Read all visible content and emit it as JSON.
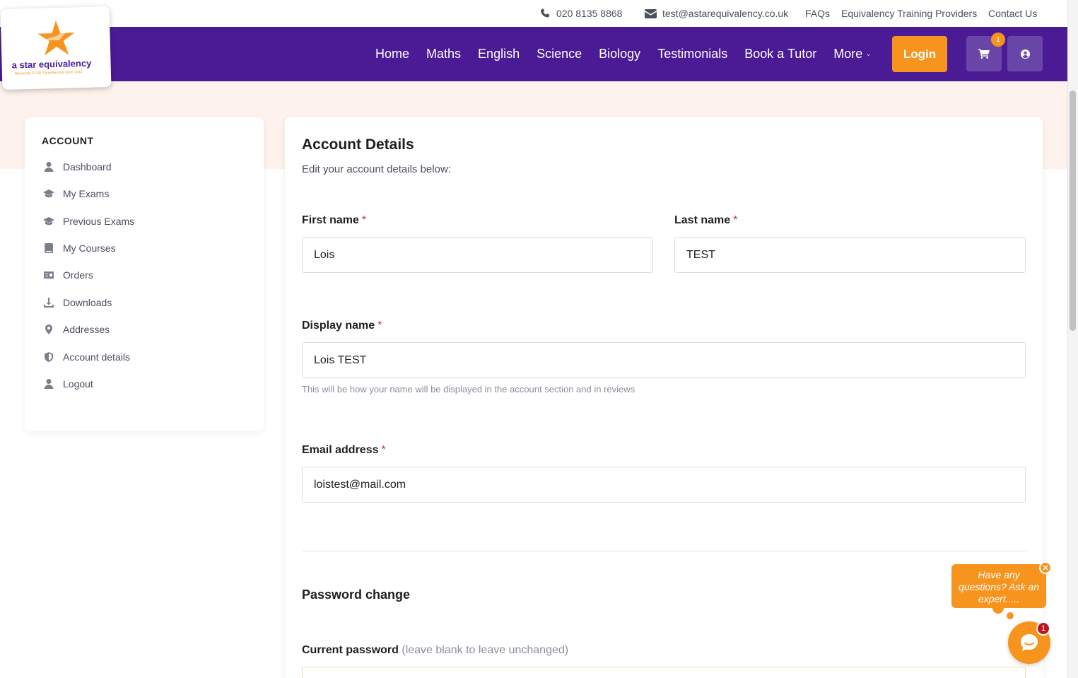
{
  "topbar": {
    "phone": "020 8135 8868",
    "email": "test@astarequivalency.co.uk",
    "links": [
      "FAQs",
      "Equivalency Training Providers",
      "Contact Us"
    ]
  },
  "logo": {
    "title": "a star equivalency",
    "tagline": "Delivering GCSE Equivalencies since 2012"
  },
  "nav": {
    "links": [
      "Home",
      "Maths",
      "English",
      "Science",
      "Biology",
      "Testimonials",
      "Book a Tutor",
      "More"
    ],
    "login_label": "Login",
    "cart_count": "1"
  },
  "sidebar": {
    "heading": "ACCOUNT",
    "items": [
      {
        "label": "Dashboard",
        "icon": "user-icon"
      },
      {
        "label": "My Exams",
        "icon": "graduation-cap-icon"
      },
      {
        "label": "Previous Exams",
        "icon": "graduation-cap-icon"
      },
      {
        "label": "My Courses",
        "icon": "book-icon"
      },
      {
        "label": "Orders",
        "icon": "receipt-icon"
      },
      {
        "label": "Downloads",
        "icon": "download-icon"
      },
      {
        "label": "Addresses",
        "icon": "map-pin-icon"
      },
      {
        "label": "Account details",
        "icon": "shield-icon"
      },
      {
        "label": "Logout",
        "icon": "user-icon"
      }
    ]
  },
  "main": {
    "title": "Account Details",
    "subtitle": "Edit your account details below:",
    "first_name_label": "First name",
    "first_name_value": "Lois",
    "last_name_label": "Last name",
    "last_name_value": "TEST",
    "display_name_label": "Display name",
    "display_name_value": "Lois TEST",
    "display_name_help": "This will be how your name will be displayed in the account section and in reviews",
    "email_label": "Email address",
    "email_value": "loistest@mail.com",
    "required_mark": "*",
    "password_section_title": "Password change",
    "current_password_label": "Current password",
    "current_password_hint": "(leave blank to leave unchanged)"
  },
  "chat": {
    "prompt": "Have any questions? Ask an expert.....",
    "close_label": "✕",
    "badge_count": "1"
  },
  "colors": {
    "brand_purple": "#4b1b96",
    "brand_orange": "#f7941d",
    "required_red": "#d0312d"
  }
}
